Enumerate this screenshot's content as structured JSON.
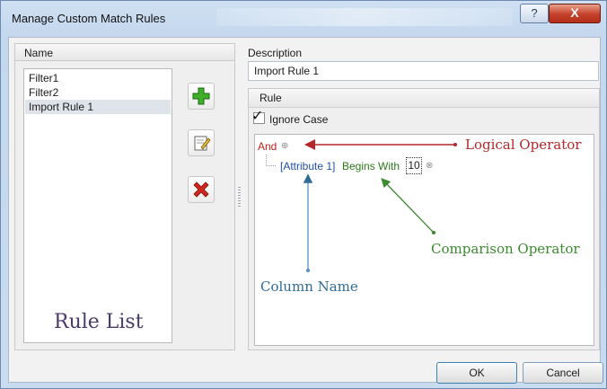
{
  "window": {
    "title": "Manage Custom Match Rules",
    "help_label": "?",
    "close_label": "X"
  },
  "left": {
    "header": "Name",
    "rules": [
      "Filter1",
      "Filter2",
      "Import Rule 1"
    ],
    "selected_rule": "Import Rule 1",
    "caption": "Rule List",
    "buttons": {
      "add": "add-icon",
      "edit": "edit-icon",
      "delete": "delete-icon"
    }
  },
  "right": {
    "description_label": "Description",
    "description_value": "Import Rule 1",
    "rule_header": "Rule",
    "ignore_case_label": "Ignore Case",
    "ignore_case_checked": true,
    "expression": {
      "logical_operator": "And",
      "column": "[Attribute 1]",
      "comparison": "Begins With",
      "value": "10"
    },
    "annotations": {
      "logical": "Logical Operator",
      "comparison": "Comparison Operator",
      "column": "Column Name"
    }
  },
  "footer": {
    "ok": "OK",
    "cancel": "Cancel"
  },
  "colors": {
    "logical": "#c0201a",
    "column": "#1f4fa8",
    "comparison": "#2c7a1c"
  }
}
